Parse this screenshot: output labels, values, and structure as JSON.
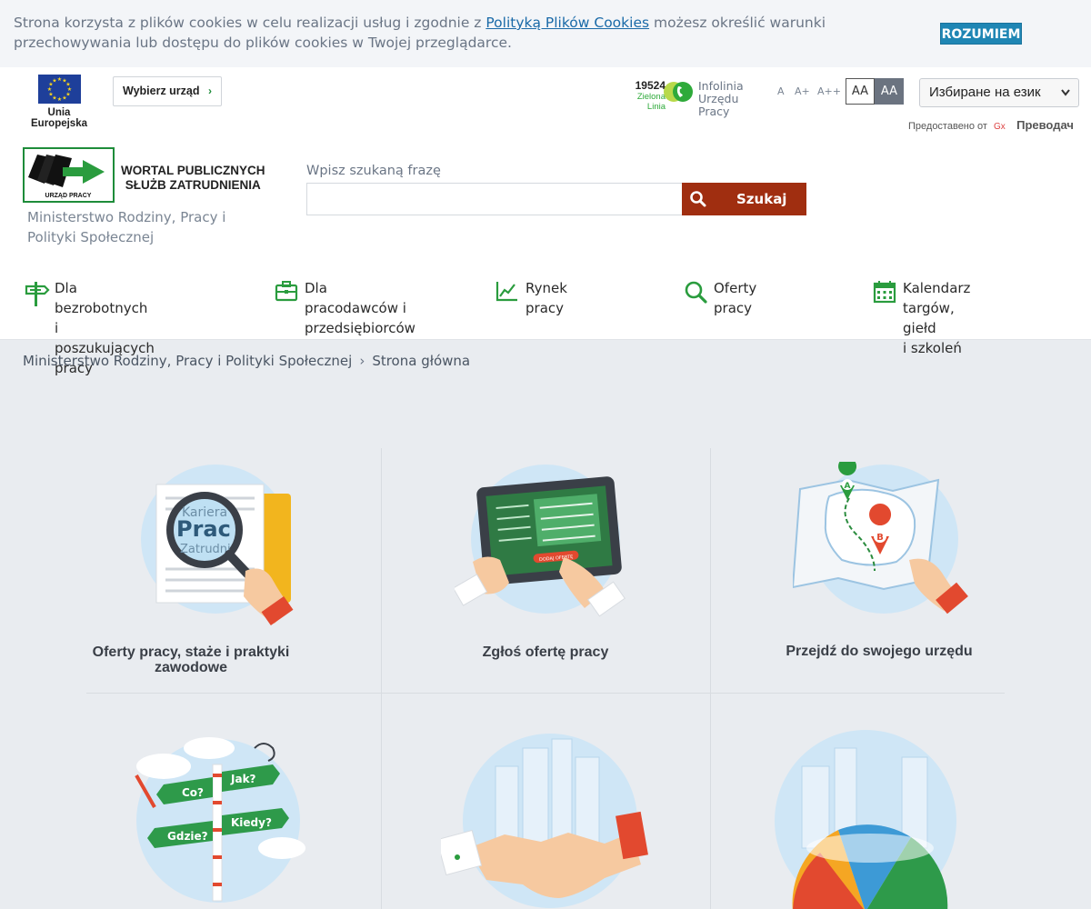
{
  "cookie": {
    "text_before": "Strona korzysta z plików cookies w celu realizacji usług i zgodnie z ",
    "link": "Polityką Plików Cookies",
    "text_after": " możesz określić warunki przechowywania lub dostępu do plików cookies w Twojej przeglądarce.",
    "button": "ROZUMIEM"
  },
  "header": {
    "eu_label": "Unia Europejska",
    "office_button": "Wybierz urząd",
    "infoline_number": "19524",
    "infoline_zielona": "Zielona Linia",
    "infoline_line1": "Infolinia",
    "infoline_line2": "Urzędu Pracy",
    "font_sizes": [
      "A",
      "A+",
      "A++"
    ],
    "contrast_normal": "AA",
    "contrast_high": "AA",
    "language_select": "Избиране на език",
    "powered_by": "Предоставено от",
    "translate": "Преводач",
    "logo_sign": "URZĄD PRACY",
    "logo_title_1": "WORTAL PUBLICZNYCH",
    "logo_title_2": "SŁUŻB ZATRUDNIENIA",
    "ministry": "Ministerstwo Rodziny, Pracy i Polityki Społecznej"
  },
  "search": {
    "label": "Wpisz szukaną frazę",
    "placeholder": "",
    "button": "Szukaj"
  },
  "nav": [
    {
      "line1": "Dla bezrobotnych i",
      "line2": "poszukujących pracy",
      "icon": "signpost-icon"
    },
    {
      "line1": "Dla pracodawców i",
      "line2": "przedsiębiorców",
      "icon": "briefcase-icon"
    },
    {
      "line1": "Rynek pracy",
      "line2": "",
      "icon": "chart-icon"
    },
    {
      "line1": "Oferty pracy",
      "line2": "",
      "icon": "magnifier-icon"
    },
    {
      "line1": "Kalendarz targów, giełd",
      "line2": "i szkoleń",
      "icon": "calendar-icon"
    }
  ],
  "breadcrumb": {
    "items": [
      "Ministerstwo Rodziny, Pracy i Polityki Społecznej",
      "Strona główna"
    ],
    "separator": "›"
  },
  "tiles": [
    {
      "line1": "Oferty pracy, staże i praktyki",
      "line2": "zawodowe",
      "lens_word1": "Kariera",
      "lens_word2": "Prac",
      "lens_word3": "Zatrudni"
    },
    {
      "line1": "Zgłoś ofertę pracy",
      "line2": "",
      "tablet_button": "DODAJ OFERTĘ"
    },
    {
      "line1": "Przejdź do swojego urzędu",
      "line2": "",
      "pin_a": "A",
      "pin_b": "B"
    },
    {
      "line1": "",
      "line2": "",
      "signs": [
        "Co?",
        "Jak?",
        "Gdzie?",
        "Kiedy?"
      ]
    },
    {
      "line1": "",
      "line2": ""
    },
    {
      "line1": "",
      "line2": ""
    }
  ],
  "colors": {
    "primary_green": "#1e8c3a",
    "search_button": "#a02e10",
    "cookie_button": "#1f86b4",
    "page_bg": "#e9ecf0"
  }
}
